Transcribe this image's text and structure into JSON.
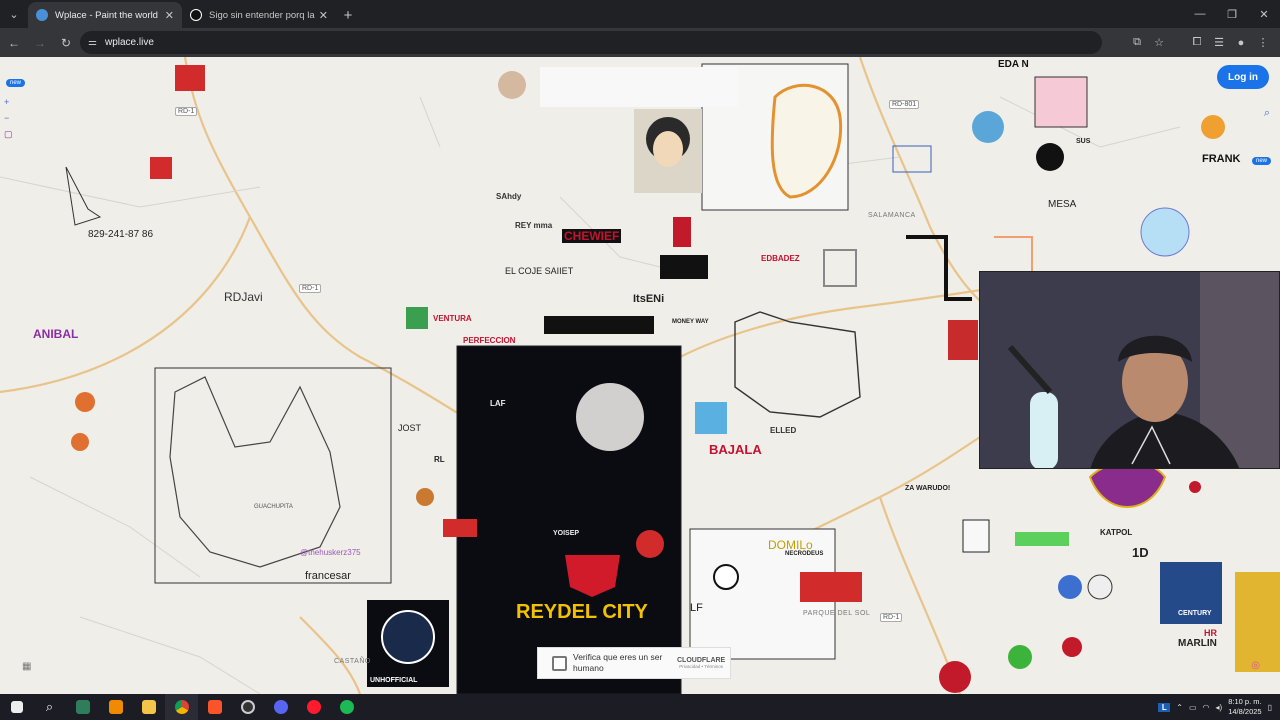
{
  "browser": {
    "tabs": [
      {
        "title": "Wplace - Paint the world",
        "active": true,
        "favicon_color": "#4a90d9"
      },
      {
        "title": "Sigo sin entender porq la gent",
        "active": false,
        "favicon_color": "#ffffff"
      }
    ],
    "url": "wplace.live",
    "icons": {
      "tab_search": "chevron-down-icon",
      "new_tab": "plus-icon",
      "back": "back-arrow-icon",
      "forward": "forward-arrow-icon",
      "reload": "reload-icon",
      "site_info": "tune-icon",
      "cast": "cast-icon",
      "bookmark": "star-icon",
      "extensions": "puzzle-icon",
      "reading": "reading-list-icon",
      "profile": "avatar",
      "menu": "kebab-icon",
      "minimize": "minimize-icon",
      "maximize": "restore-icon",
      "close": "close-icon"
    }
  },
  "wplace": {
    "login_label": "Log in",
    "new_badge": "new",
    "accent": "#1a73e8"
  },
  "map_labels": {
    "roads": [
      "RD-1",
      "RD-801",
      "RD-1",
      "RD-1"
    ],
    "towns": [
      "SALAMANCA",
      "CASTAÑO",
      "PARQUE DEL SOL"
    ]
  },
  "pixel_art": [
    {
      "text": "EDA N",
      "color": "#111111"
    },
    {
      "text": "FRANK",
      "color": "#111111"
    },
    {
      "text": "MESA",
      "color": "#222222"
    },
    {
      "text": "829-241-87 86",
      "color": "#222222"
    },
    {
      "text": "ANIBAL",
      "color": "#8b2fa0"
    },
    {
      "text": "RDJavi",
      "color": "#333333"
    },
    {
      "text": "CHEWIEF",
      "color": "#c41230"
    },
    {
      "text": "REY mma",
      "color": "#333333"
    },
    {
      "text": "SAhdy",
      "color": "#333333"
    },
    {
      "text": "EL COJE SAIIET",
      "color": "#222222"
    },
    {
      "text": "ItsENi",
      "color": "#222222"
    },
    {
      "text": "EDBADEZ",
      "color": "#c41230"
    },
    {
      "text": "VENTURA",
      "color": "#c41230"
    },
    {
      "text": "PERFECCION",
      "color": "#c41230"
    },
    {
      "text": "MONEY WAY",
      "color": "#222222"
    },
    {
      "text": "ELLED",
      "color": "#333333"
    },
    {
      "text": "JOST",
      "color": "#222222"
    },
    {
      "text": "RL",
      "color": "#222222"
    },
    {
      "text": "LAF",
      "color": "#222222"
    },
    {
      "text": "ZA WARUDO!",
      "color": "#222222"
    },
    {
      "text": "GUACHUPITA",
      "color": "#555555"
    },
    {
      "text": "@thehuskerz375",
      "color": "#9b59b6"
    },
    {
      "text": "francesar",
      "color": "#222222"
    },
    {
      "text": "DOMILo",
      "color": "#c2a000"
    },
    {
      "text": "NECRODEUS",
      "color": "#222222"
    },
    {
      "text": "REYDEL CITY",
      "color": "#f2c200"
    },
    {
      "text": "YOISEP",
      "color": "#eeeeee"
    },
    {
      "text": "KATPOL",
      "color": "#222222"
    },
    {
      "text": "1D",
      "color": "#222222"
    },
    {
      "text": "SUS",
      "color": "#222222"
    },
    {
      "text": "CENTURY",
      "color": "#ffffff"
    },
    {
      "text": "MARLIN",
      "color": "#222222"
    },
    {
      "text": "UNHOFFICIAL",
      "color": "#ffffff"
    },
    {
      "text": "HR",
      "color": "#c41230"
    },
    {
      "text": "LF",
      "color": "#222222"
    },
    {
      "text": "BAJALA",
      "color": "#c41230"
    }
  ],
  "captcha": {
    "text": "Verifica que eres un ser humano",
    "brand": "CLOUDFLARE",
    "links": "Privacidad • Términos"
  },
  "taskbar": {
    "apps": [
      "windows-icon",
      "search-icon",
      "terminal-icon",
      "vlc-icon",
      "folder-icon",
      "chrome-icon",
      "brave-icon",
      "obs-icon",
      "discord-icon",
      "opera-icon",
      "spotify-icon"
    ],
    "lang": "L",
    "time": "8:10 p. m.",
    "date": "14/8/2025"
  }
}
